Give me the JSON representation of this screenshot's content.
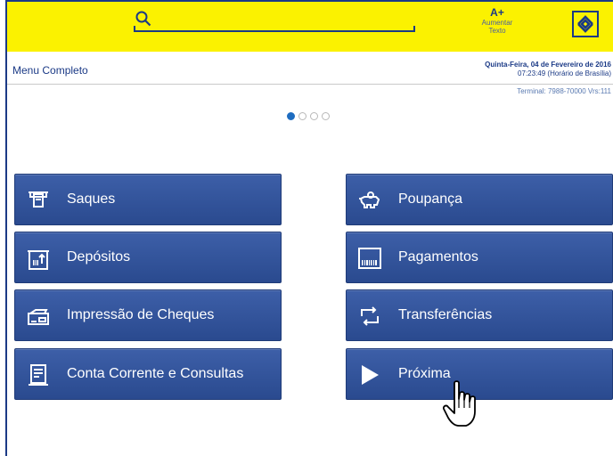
{
  "header": {
    "font_size_button": {
      "label": "A+",
      "sub1": "Aumentar",
      "sub2": "Texto"
    },
    "icons": {
      "search": "search-icon",
      "logo": "banco-do-brasil-logo"
    }
  },
  "subheader": {
    "title": "Menu Completo",
    "date": "Quinta-Feira, 04 de Fevereiro de 2016",
    "time": "07:23:49 (Horário de Brasília)",
    "terminal": "Terminal: 7988-70000 Vrs:111"
  },
  "pager": {
    "pages": 4,
    "current": 1
  },
  "menu": {
    "left": [
      {
        "label": "Saques",
        "icon": "cash-withdrawal-icon"
      },
      {
        "label": "Depósitos",
        "icon": "deposit-icon"
      },
      {
        "label": "Impressão de Cheques",
        "icon": "cheque-printer-icon"
      },
      {
        "label": "Conta Corrente e Consultas",
        "icon": "statement-icon"
      }
    ],
    "right": [
      {
        "label": "Poupança",
        "icon": "piggy-bank-icon"
      },
      {
        "label": "Pagamentos",
        "icon": "barcode-icon"
      },
      {
        "label": "Transferências",
        "icon": "transfer-arrows-icon"
      },
      {
        "label": "Próxima",
        "icon": "play-arrow-icon"
      }
    ]
  },
  "colors": {
    "header_bg": "#fbf200",
    "brand_blue": "#1b3a86",
    "tile_bg": "#2f4f95",
    "pager_active": "#1e6cc0"
  }
}
